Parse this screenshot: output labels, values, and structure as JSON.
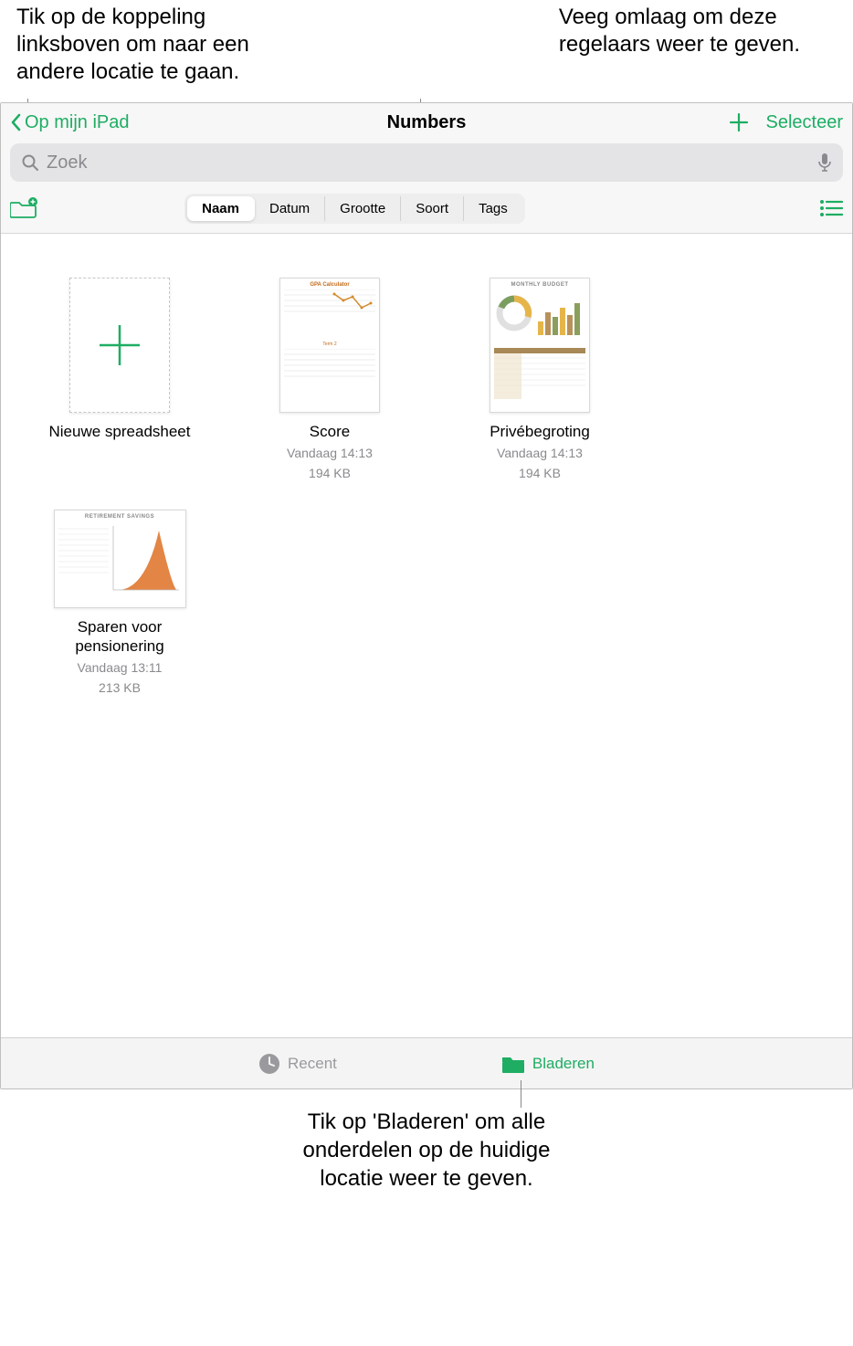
{
  "callouts": {
    "top_left": "Tik op de koppeling\nlinksboven om naar een\nandere locatie te gaan.",
    "top_right": "Veeg omlaag om deze\nregelaars weer te geven.",
    "bottom": "Tik op 'Bladeren' om alle\nonderdelen op de huidige\nlocatie weer te geven."
  },
  "header": {
    "back_label": "Op mijn iPad",
    "title": "Numbers",
    "select_label": "Selecteer"
  },
  "search": {
    "placeholder": "Zoek"
  },
  "sort_segments": [
    "Naam",
    "Datum",
    "Grootte",
    "Soort",
    "Tags"
  ],
  "sort_active_index": 0,
  "documents": [
    {
      "name": "Nieuwe spreadsheet",
      "date": "",
      "size": "",
      "type": "new"
    },
    {
      "name": "Score",
      "date": "Vandaag 14:13",
      "size": "194 KB",
      "type": "gpa"
    },
    {
      "name": "Privébegroting",
      "date": "Vandaag 14:13",
      "size": "194 KB",
      "type": "budget"
    },
    {
      "name": "Sparen voor\npensionering",
      "date": "Vandaag 13:11",
      "size": "213 KB",
      "type": "retirement"
    }
  ],
  "tabs": {
    "recent": "Recent",
    "browse": "Bladeren"
  }
}
